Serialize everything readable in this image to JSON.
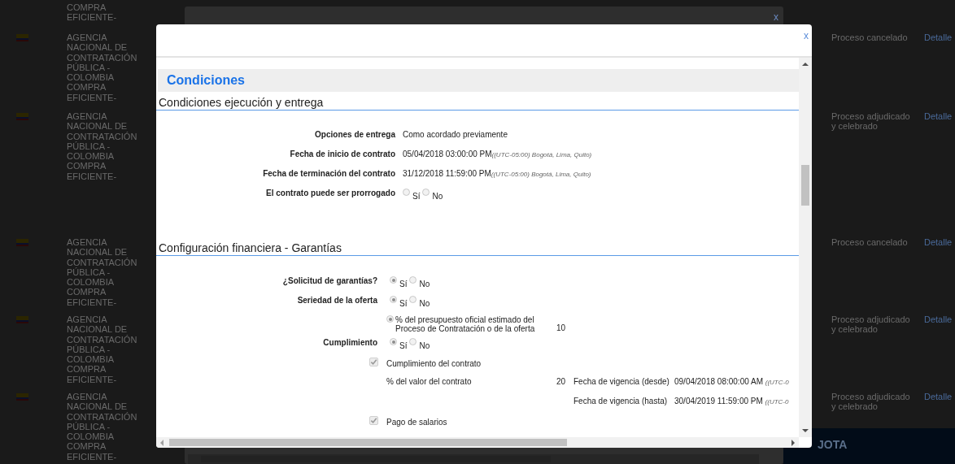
{
  "background": {
    "rows": [
      {
        "flag": false,
        "agency": "COMPRA EFICIENTE-",
        "status": "",
        "link": ""
      },
      {
        "flag": true,
        "agency": "AGENCIA NACIONAL DE CONTRATACIÓN PÚBLICA - COLOMBIA COMPRA EFICIENTE-",
        "status": "Proceso cancelado",
        "link": "Detalle"
      },
      {
        "flag": true,
        "agency": "AGENCIA NACIONAL DE CONTRATACIÓN PÚBLICA - COLOMBIA COMPRA EFICIENTE-",
        "status": "Proceso adjudicado y celebrado",
        "link": "Detalle"
      },
      {
        "flag": true,
        "agency": "AGENCIA NACIONAL DE CONTRATACIÓN PÚBLICA - COLOMBIA COMPRA EFICIENTE-",
        "status": "Proceso cancelado",
        "link": "Detalle"
      },
      {
        "flag": true,
        "agency": "AGENCIA NACIONAL DE CONTRATACIÓN PÚBLICA - COLOMBIA COMPRA EFICIENTE-",
        "status": "Proceso adjudicado y celebrado",
        "link": "Detalle"
      },
      {
        "flag": true,
        "agency": "AGENCIA NACIONAL DE CONTRATACIÓN PÚBLICA - COLOMBIA COMPRA EFICIENTE-",
        "status": "Proceso adjudicado y celebrado",
        "link": "Detalle"
      }
    ],
    "footer": "JOTA",
    "back_modal_close": "x"
  },
  "modal": {
    "close": "x",
    "title": "Condiciones",
    "sections": [
      {
        "heading": "Condiciones ejecución y entrega",
        "rows": [
          {
            "kind": "text",
            "label": "Opciones de entrega",
            "value": "Como acordado previamente"
          },
          {
            "kind": "date",
            "label": "Fecha de inicio de contrato",
            "value": "05/04/2018 03:00:00 PM",
            "zone": "((UTC-05:00) Bogotá, Lima, Quito)"
          },
          {
            "kind": "date",
            "label": "Fecha de terminación del contrato",
            "value": "31/12/2018 11:59:00 PM",
            "zone": "((UTC-05:00) Bogotá, Lima, Quito)"
          },
          {
            "kind": "radio",
            "label": "El contrato puede ser prorrogado",
            "options": [
              {
                "label": "Sí",
                "selected": false
              },
              {
                "label": "No",
                "selected": false
              }
            ]
          }
        ]
      },
      {
        "heading": "Configuración financiera - Garantías",
        "rows": [
          {
            "kind": "radio",
            "label": "¿Solicitud de garantías?",
            "options": [
              {
                "label": "Sí",
                "selected": true
              },
              {
                "label": "No",
                "selected": false
              }
            ]
          },
          {
            "kind": "radio",
            "label": "Seriedad de la oferta",
            "options": [
              {
                "label": "Sí",
                "selected": true
              },
              {
                "label": "No",
                "selected": false
              }
            ]
          },
          {
            "kind": "option",
            "selected": true,
            "text": "% del presupuesto oficial estimado del Proceso de Contratación o de la oferta",
            "amount": "10"
          },
          {
            "kind": "radio",
            "label": "Cumplimiento",
            "options": [
              {
                "label": "Sí",
                "selected": true
              },
              {
                "label": "No",
                "selected": false
              }
            ]
          },
          {
            "kind": "check",
            "checked": true,
            "text": "Cumplimiento del contrato"
          },
          {
            "kind": "amount",
            "text": "% del valor del contrato",
            "amount": "20",
            "date_label": "Fecha de vigencia (desde)",
            "value": "09/04/2018 08:00:00 AM",
            "zone": "((UTC-0"
          },
          {
            "kind": "amount",
            "text": "",
            "amount": "",
            "date_label": "Fecha de vigencia (hasta)",
            "value": "30/04/2019 11:59:00 PM",
            "zone": "((UTC-0"
          },
          {
            "kind": "check",
            "checked": true,
            "text": "Pago de salarios"
          }
        ]
      }
    ]
  }
}
